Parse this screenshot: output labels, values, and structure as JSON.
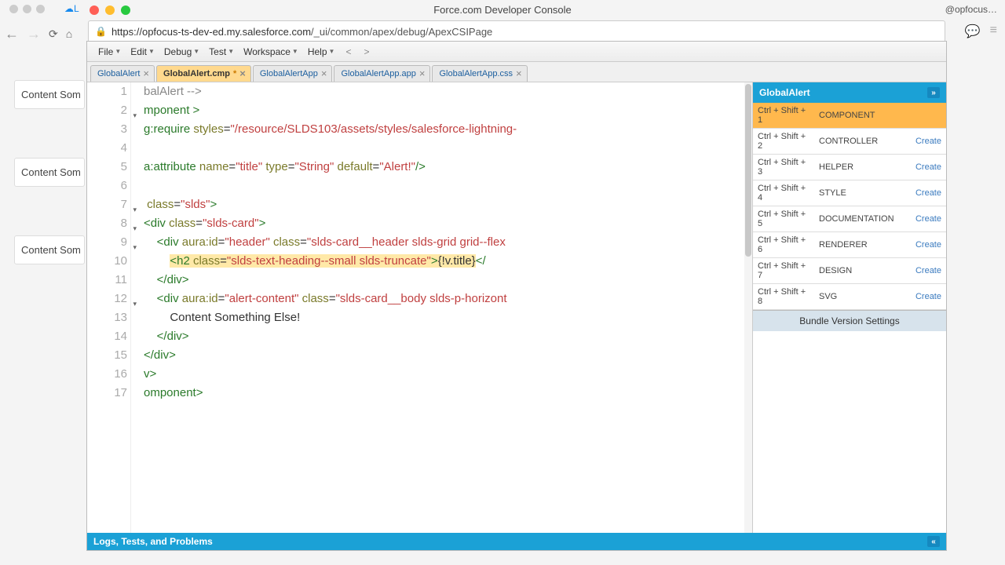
{
  "window": {
    "title": "Force.com Developer Console",
    "right_tab": "@opfocus…"
  },
  "url": {
    "host": "https://opfocus-ts-dev-ed.my.salesforce.com",
    "path": "/_ui/common/apex/debug/ApexCSIPage"
  },
  "cloud_tab": "L",
  "bg_cards": [
    "Content Som",
    "Content Som",
    "Content Som"
  ],
  "menus": [
    "File",
    "Edit",
    "Debug",
    "Test",
    "Workspace",
    "Help"
  ],
  "nav_prev": "<",
  "nav_next": ">",
  "tabs": [
    {
      "label": "GlobalAlert",
      "active": false,
      "dirty": false
    },
    {
      "label": "GlobalAlert.cmp",
      "active": true,
      "dirty": true
    },
    {
      "label": "GlobalAlertApp",
      "active": false,
      "dirty": false
    },
    {
      "label": "GlobalAlertApp.app",
      "active": false,
      "dirty": false
    },
    {
      "label": "GlobalAlertApp.css",
      "active": false,
      "dirty": false
    }
  ],
  "code": {
    "lines": [
      {
        "n": 1,
        "fold": "",
        "html": "<span class='t-comment'>balAlert --&gt;</span>"
      },
      {
        "n": 2,
        "fold": "▾",
        "html": "<span class='t-tag'>mponent &gt;</span>"
      },
      {
        "n": 3,
        "fold": "",
        "html": "<span class='t-tag'>g:require</span> <span class='t-attr'>styles</span>=<span class='t-str'>\"/resource/SLDS103/assets/styles/salesforce-lightning-</span>"
      },
      {
        "n": 4,
        "fold": "",
        "html": ""
      },
      {
        "n": 5,
        "fold": "",
        "html": "<span class='t-tag'>a:attribute</span> <span class='t-attr'>name</span>=<span class='t-str'>\"title\"</span> <span class='t-attr'>type</span>=<span class='t-str'>\"String\"</span> <span class='t-attr'>default</span>=<span class='t-str'>\"Alert!\"</span><span class='t-tag'>/&gt;</span>"
      },
      {
        "n": 6,
        "fold": "",
        "html": ""
      },
      {
        "n": 7,
        "fold": "▾",
        "html": " <span class='t-attr'>class</span>=<span class='t-str'>\"slds\"</span><span class='t-tag'>&gt;</span>"
      },
      {
        "n": 8,
        "fold": "▾",
        "html": "<span class='t-tag'>&lt;div</span> <span class='t-attr'>class</span>=<span class='t-str'>\"slds-card\"</span><span class='t-tag'>&gt;</span>"
      },
      {
        "n": 9,
        "fold": "▾",
        "html": "    <span class='t-tag'>&lt;div</span> <span class='t-attr'>aura:id</span>=<span class='t-str'>\"header\"</span> <span class='t-attr'>class</span>=<span class='t-str'>\"slds-card__header slds-grid grid--flex</span>"
      },
      {
        "n": 10,
        "fold": "",
        "html": "        <span class='hl'><span class='t-tag'>&lt;h2</span> <span class='t-attr'>class</span>=<span class='t-str'>\"slds-text-heading--small slds-truncate\"</span><span class='t-tag'>&gt;</span>{!v.title}</span><span class='t-tag'>&lt;/</span>"
      },
      {
        "n": 11,
        "fold": "",
        "html": "    <span class='t-tag'>&lt;/div&gt;</span>"
      },
      {
        "n": 12,
        "fold": "▾",
        "html": "    <span class='t-tag'>&lt;div</span> <span class='t-attr'>aura:id</span>=<span class='t-str'>\"alert-content\"</span> <span class='t-attr'>class</span>=<span class='t-str'>\"slds-card__body slds-p-horizont</span>"
      },
      {
        "n": 13,
        "fold": "",
        "html": "        Content Something Else!"
      },
      {
        "n": 14,
        "fold": "",
        "html": "    <span class='t-tag'>&lt;/div&gt;</span>"
      },
      {
        "n": 15,
        "fold": "",
        "html": "<span class='t-tag'>&lt;/div&gt;</span>"
      },
      {
        "n": 16,
        "fold": "",
        "html": "<span class='t-tag'>v&gt;</span>"
      },
      {
        "n": 17,
        "fold": "",
        "html": "<span class='t-tag'>omponent&gt;</span>"
      }
    ]
  },
  "sidebar": {
    "title": "GlobalAlert",
    "rows": [
      {
        "shortcut": "Ctrl + Shift + 1",
        "label": "COMPONENT",
        "action": "",
        "selected": true
      },
      {
        "shortcut": "Ctrl + Shift + 2",
        "label": "CONTROLLER",
        "action": "Create",
        "selected": false
      },
      {
        "shortcut": "Ctrl + Shift + 3",
        "label": "HELPER",
        "action": "Create",
        "selected": false
      },
      {
        "shortcut": "Ctrl + Shift + 4",
        "label": "STYLE",
        "action": "Create",
        "selected": false
      },
      {
        "shortcut": "Ctrl + Shift + 5",
        "label": "DOCUMENTATION",
        "action": "Create",
        "selected": false
      },
      {
        "shortcut": "Ctrl + Shift + 6",
        "label": "RENDERER",
        "action": "Create",
        "selected": false
      },
      {
        "shortcut": "Ctrl + Shift + 7",
        "label": "DESIGN",
        "action": "Create",
        "selected": false
      },
      {
        "shortcut": "Ctrl + Shift + 8",
        "label": "SVG",
        "action": "Create",
        "selected": false
      }
    ],
    "footer": "Bundle Version Settings"
  },
  "bottom": {
    "label": "Logs, Tests, and Problems"
  }
}
